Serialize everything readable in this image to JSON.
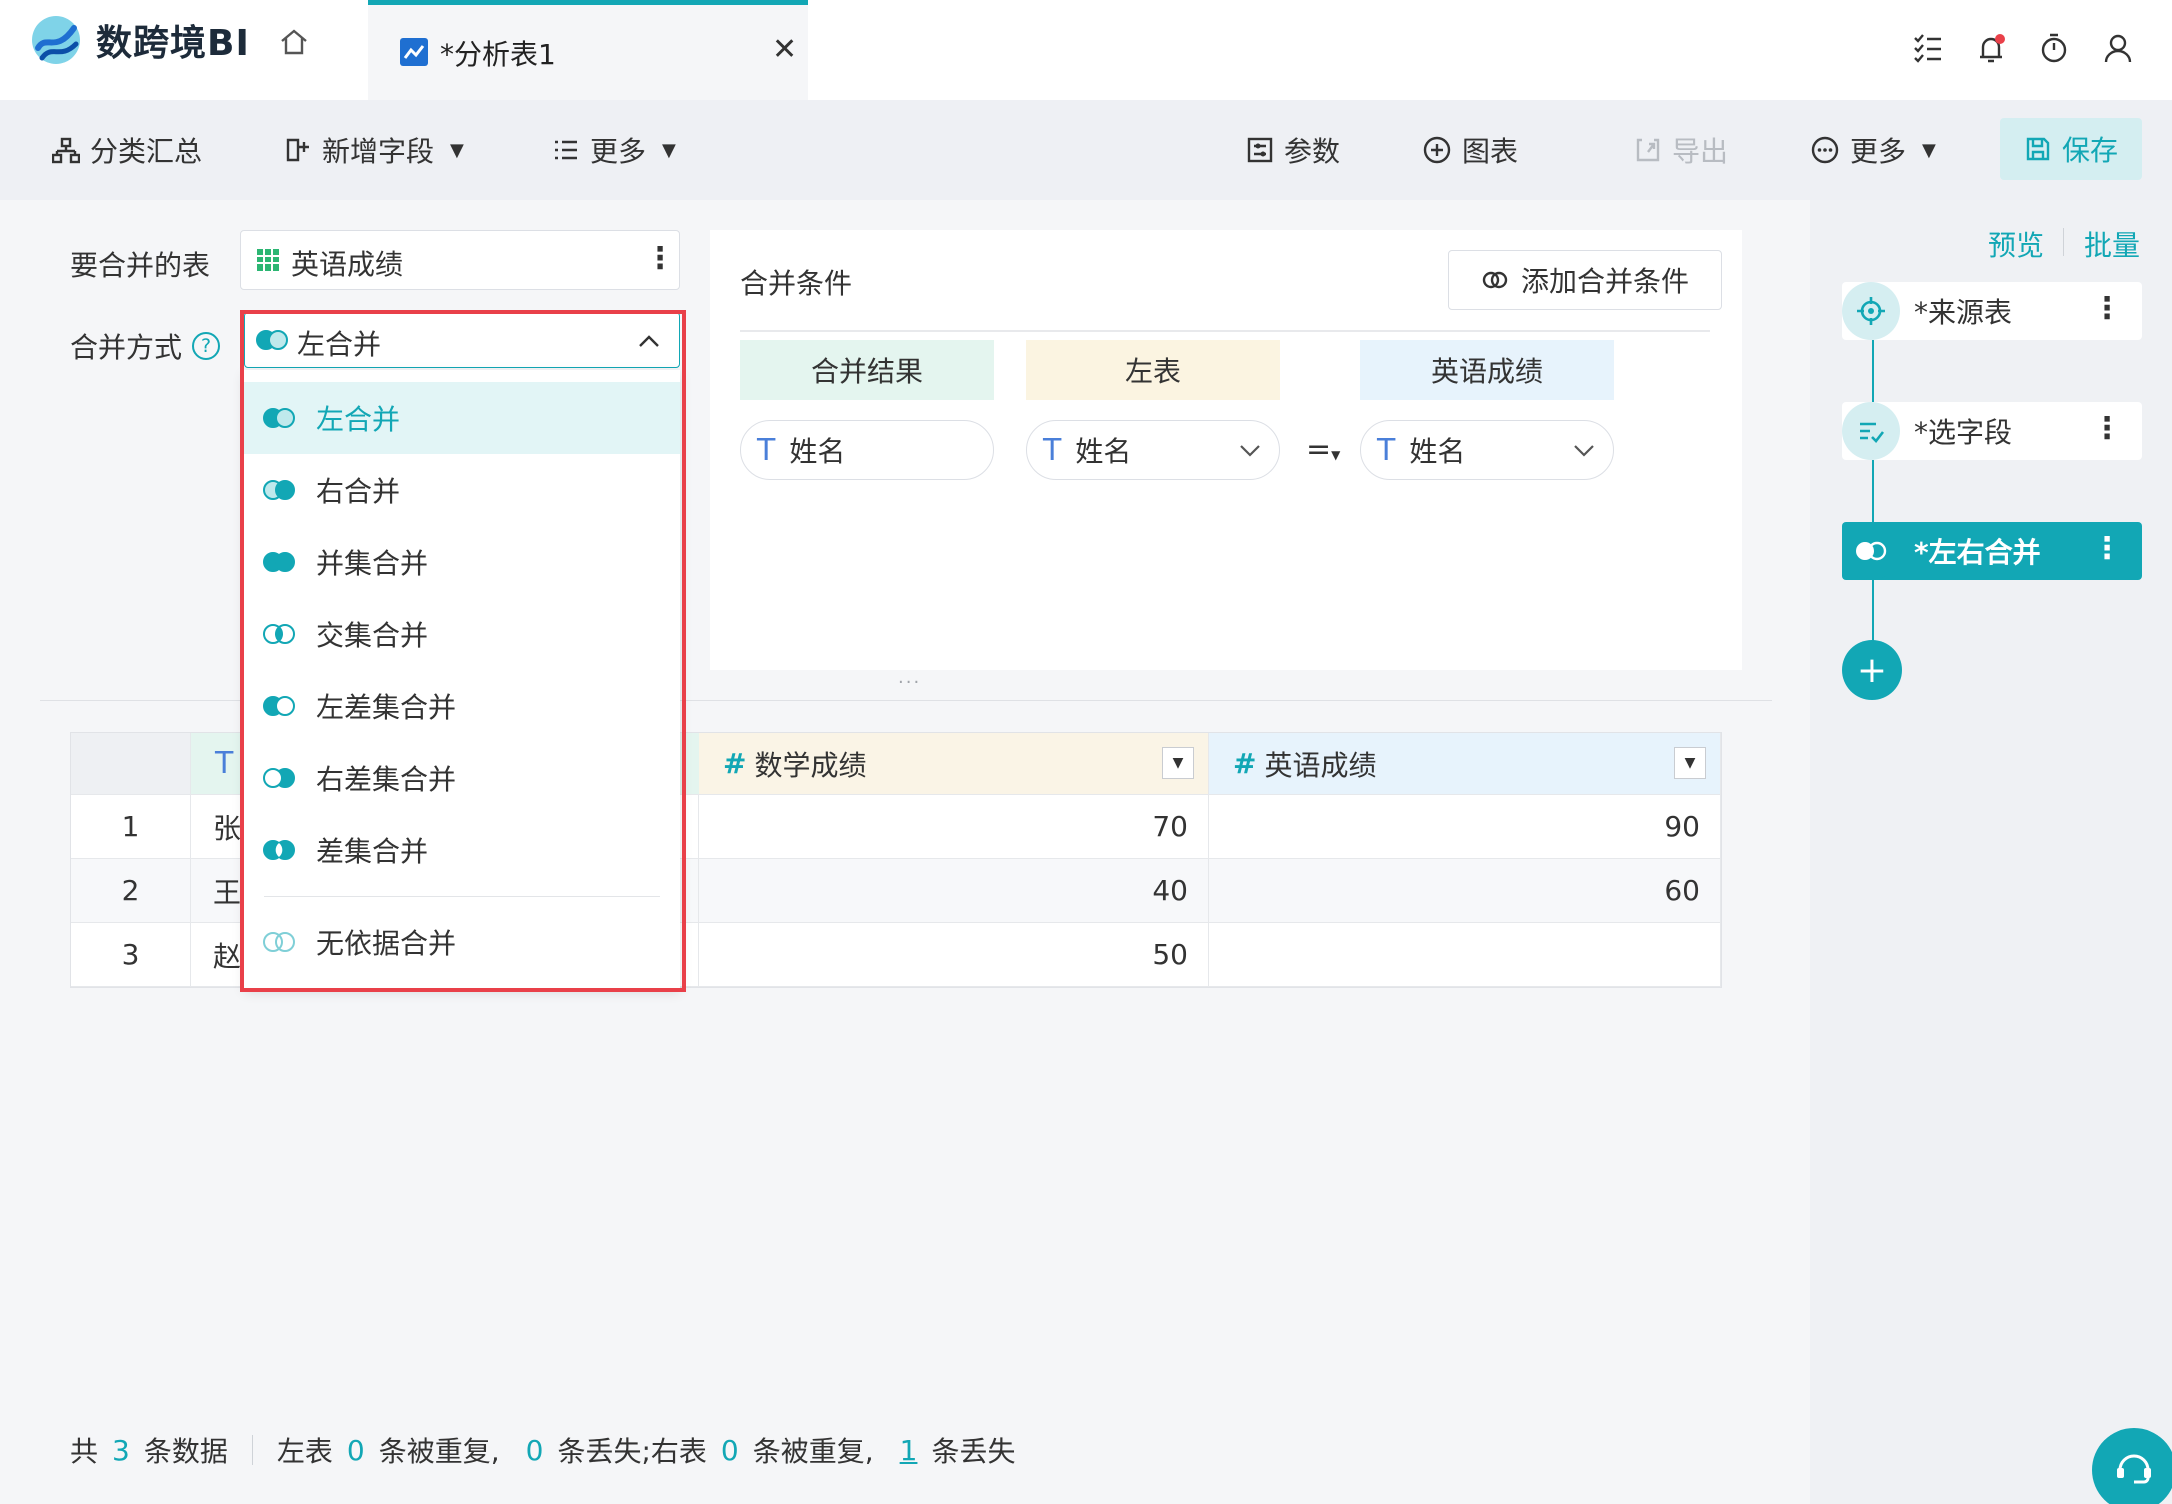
{
  "app": {
    "name": "数跨境BI"
  },
  "tab": {
    "title": "*分析表1"
  },
  "toolbar": {
    "group_summary": "分类汇总",
    "add_field": "新增字段",
    "more_left": "更多",
    "params": "参数",
    "chart": "图表",
    "export": "导出",
    "more_right": "更多",
    "save": "保存"
  },
  "form": {
    "table_label": "要合并的表",
    "table_value": "英语成绩",
    "mode_label": "合并方式",
    "mode_value": "左合并"
  },
  "dropdown": {
    "options": [
      "左合并",
      "右合并",
      "并集合并",
      "交集合并",
      "左差集合并",
      "右差集合并",
      "差集合并",
      "无依据合并"
    ],
    "selected": "左合并"
  },
  "condition": {
    "title": "合并条件",
    "add_button": "添加合并条件",
    "headers": [
      "合并结果",
      "左表",
      "英语成绩"
    ],
    "result_field": "姓名",
    "left_field": "姓名",
    "operator": "=",
    "right_field": "姓名"
  },
  "grid": {
    "columns": [
      "数学成绩",
      "英语成绩"
    ],
    "rows": [
      {
        "num": "1",
        "name": "张",
        "math": "70",
        "english": "90"
      },
      {
        "num": "2",
        "name": "王",
        "math": "40",
        "english": "60"
      },
      {
        "num": "3",
        "name": "赵",
        "math": "50",
        "english": ""
      }
    ]
  },
  "sidebar": {
    "preview": "预览",
    "batch": "批量",
    "nodes": [
      "*来源表",
      "*选字段",
      "*左右合并"
    ]
  },
  "footer": {
    "total_prefix": "共",
    "total": "3",
    "total_suffix": "条数据",
    "left_prefix": "左表",
    "left_dup": "0",
    "dup_text": "条被重复,",
    "left_lost": "0",
    "lost_text_left": "条丢失;",
    "right_prefix": "右表",
    "right_dup": "0",
    "dup_text_right": "条被重复,",
    "right_lost": "1",
    "lost_text_right": "条丢失"
  },
  "colors": {
    "accent": "#12a7b5",
    "highlight": "#e94049"
  }
}
